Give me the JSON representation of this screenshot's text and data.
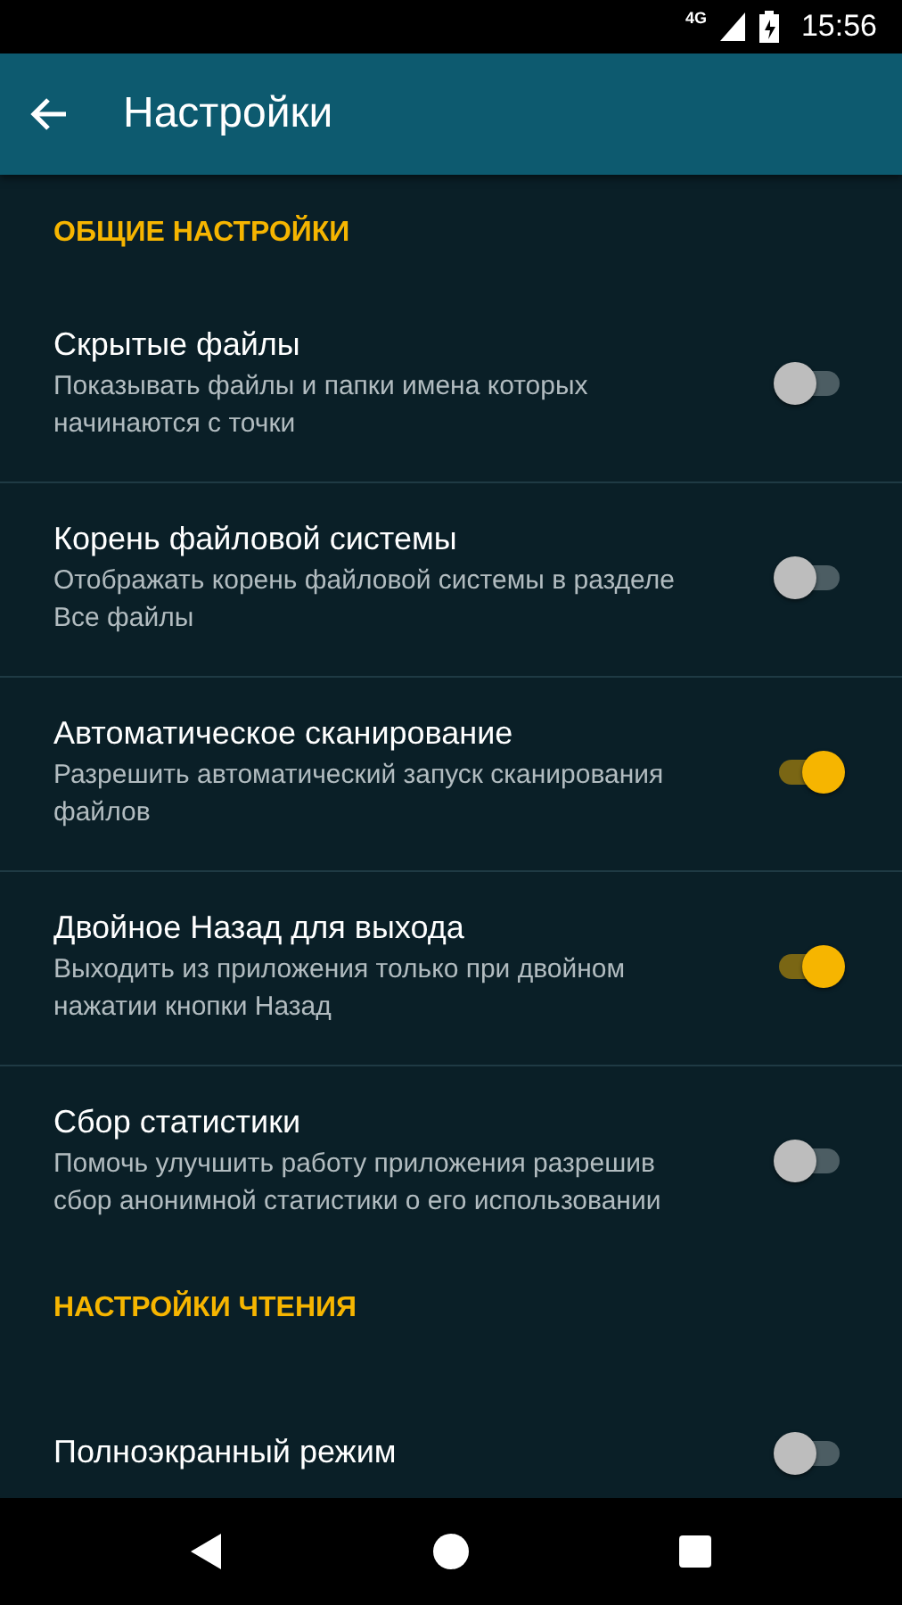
{
  "status_bar": {
    "network": "4G",
    "time": "15:56"
  },
  "app_bar": {
    "title": "Настройки"
  },
  "sections": [
    {
      "title": "ОБЩИЕ НАСТРОЙКИ",
      "items": [
        {
          "title": "Скрытые файлы",
          "summary": "Показывать файлы и папки имена которых начинаются с точки",
          "on": false
        },
        {
          "title": "Корень файловой системы",
          "summary": "Отображать корень файловой системы в разделе Все файлы",
          "on": false
        },
        {
          "title": "Автоматическое сканирование",
          "summary": "Разрешить автоматический запуск сканирования файлов",
          "on": true
        },
        {
          "title": "Двойное Назад для выхода",
          "summary": "Выходить из приложения только при двойном нажатии кнопки Назад",
          "on": true
        },
        {
          "title": "Сбор статистики",
          "summary": "Помочь улучшить работу приложения разрешив сбор анонимной статистики о его использовании",
          "on": false
        }
      ]
    },
    {
      "title": "НАСТРОЙКИ ЧТЕНИЯ",
      "items": [
        {
          "title": "Полноэкранный режим",
          "on": false
        }
      ]
    }
  ]
}
